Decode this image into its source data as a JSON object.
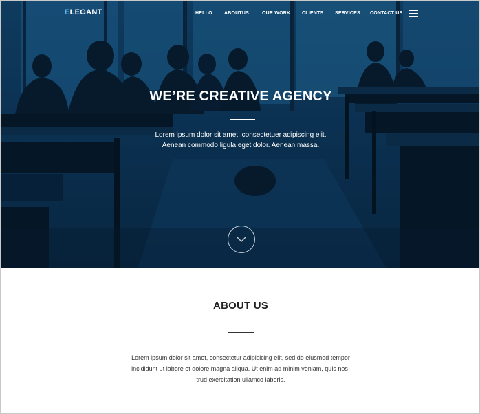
{
  "brand": {
    "logo_mark": "E",
    "logo_rest": "LEGANT"
  },
  "nav": {
    "items": [
      {
        "label": "HELLO"
      },
      {
        "label": "ABOUTUS"
      },
      {
        "label": "OUR WORK"
      },
      {
        "label": "CLIENTS"
      },
      {
        "label": "SERVICES"
      },
      {
        "label": "CONTACT US"
      }
    ],
    "menu_icon": "hamburger-menu-icon"
  },
  "hero": {
    "title": "WE’RE CREATIVE AGENCY",
    "text_line1": "Lorem ipsum dolor sit amet, consectetuer adipiscing elit.",
    "text_line2": "Aenean commodo ligula eget dolor. Aenean massa.",
    "scroll_icon": "chevron-down-icon"
  },
  "about": {
    "title": "ABOUT US",
    "text_line1": "Lorem ipsum dolor sit amet, consectetur adipisicing elit, sed do eiusmod tempor",
    "text_line2": "incididunt ut labore et dolore magna aliqua. Ut enim ad minim veniam, quis nos-",
    "text_line3": "trud exercitation ullamco laboris."
  },
  "colors": {
    "hero_overlay": "#0b3152",
    "accent": "#5fb6e8",
    "text_light": "#ffffff",
    "text_dark": "#222222"
  }
}
